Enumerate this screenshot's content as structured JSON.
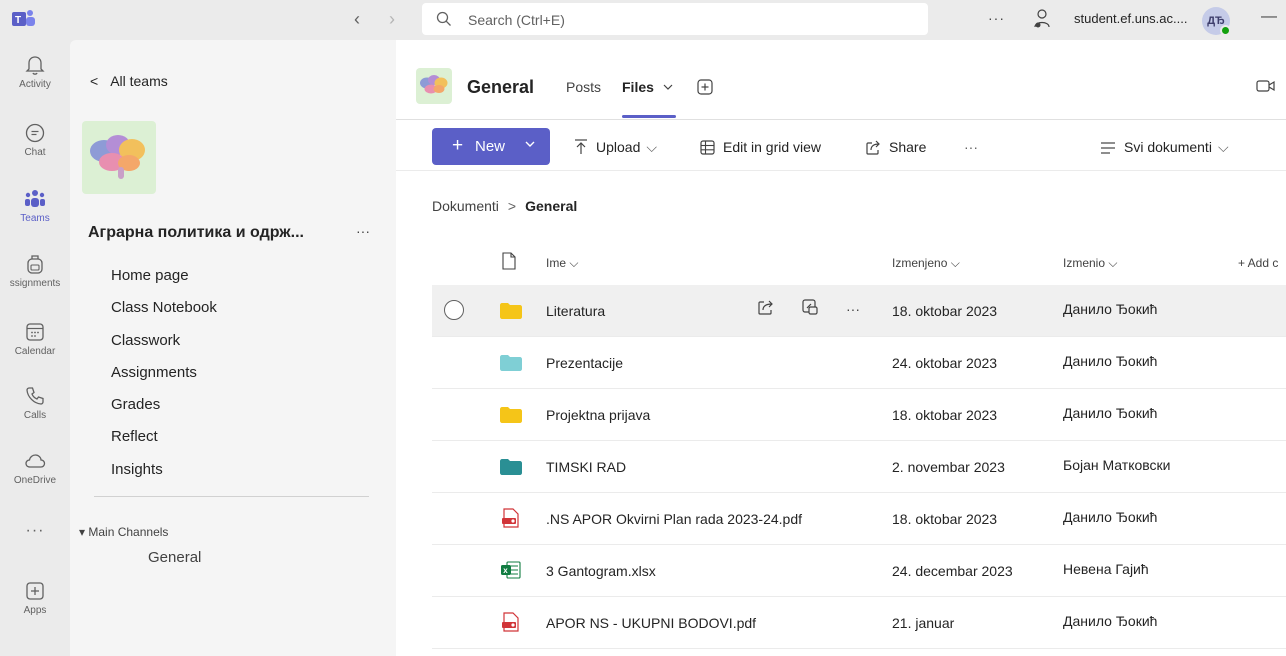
{
  "topbar": {
    "search_placeholder": "Search (Ctrl+E)",
    "more": "···",
    "user_account": "student.ef.uns.ac....",
    "user_initials": "ДЂ",
    "minimize": "—"
  },
  "rail": {
    "items": [
      {
        "label": "Activity",
        "icon": "bell-icon"
      },
      {
        "label": "Chat",
        "icon": "chat-icon"
      },
      {
        "label": "Teams",
        "icon": "teams-icon",
        "active": true
      },
      {
        "label": "ssignments",
        "icon": "backpack-icon"
      },
      {
        "label": "Calendar",
        "icon": "calendar-icon"
      },
      {
        "label": "Calls",
        "icon": "phone-icon"
      },
      {
        "label": "OneDrive",
        "icon": "cloud-icon"
      },
      {
        "label": "···",
        "icon": "more-icon"
      },
      {
        "label": "Apps",
        "icon": "apps-icon"
      }
    ]
  },
  "team_panel": {
    "back_label": "All teams",
    "team_name": "Аграрна политика и одрж...",
    "more": "···",
    "nav": [
      "Home page",
      "Class Notebook",
      "Classwork",
      "Assignments",
      "Grades",
      "Reflect",
      "Insights"
    ],
    "channels_section": "Main Channels",
    "channel": "General"
  },
  "channel": {
    "title": "General",
    "tabs": {
      "posts": "Posts",
      "files": "Files"
    }
  },
  "toolbar": {
    "new": "New",
    "upload": "Upload",
    "edit_grid": "Edit in grid view",
    "share": "Share",
    "more": "···",
    "view": "Svi dokumenti"
  },
  "breadcrumb": {
    "root": "Dokumenti",
    "current": "General"
  },
  "columns": {
    "name": "Ime",
    "modified": "Izmenjeno",
    "modified_by": "Izmenio",
    "add_column": "+ Add c"
  },
  "files": [
    {
      "name": "Literatura",
      "date": "18. oktobar 2023",
      "by": "Данило Ђокић",
      "type": "folder",
      "color": "#f5c518"
    },
    {
      "name": "Prezentacije",
      "date": "24. oktobar 2023",
      "by": "Данило Ђокић",
      "type": "folder",
      "color": "#7fcfd5"
    },
    {
      "name": "Projektna prijava",
      "date": "18. oktobar 2023",
      "by": "Данило Ђокић",
      "type": "folder",
      "color": "#f5c518"
    },
    {
      "name": "TIMSKI RAD",
      "date": "2. novembar 2023",
      "by": "Бојан Матковски",
      "type": "folder",
      "color": "#2a8f94"
    },
    {
      "name": ".NS APOR Okvirni Plan rada 2023-24.pdf",
      "date": "18. oktobar 2023",
      "by": "Данило Ђокић",
      "type": "pdf",
      "color": "#d13438"
    },
    {
      "name": "3 Gantogram.xlsx",
      "date": "24. decembar 2023",
      "by": "Невена Гајић",
      "type": "xlsx",
      "color": "#107c41"
    },
    {
      "name": "APOR NS - UKUPNI BODOVI.pdf",
      "date": "21. januar",
      "by": "Данило Ђокић",
      "type": "pdf",
      "color": "#d13438"
    }
  ],
  "colors": {
    "accent": "#5b5fc7",
    "presence": "#13a10e"
  }
}
